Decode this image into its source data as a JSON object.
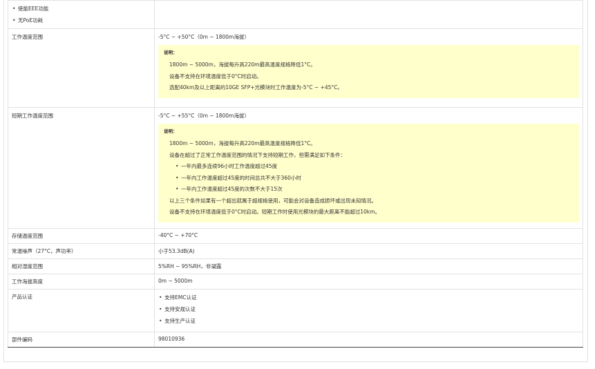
{
  "top_features": [
    "使能EEE功能",
    "无PoE功耗"
  ],
  "rows": {
    "op_temp": {
      "key": "工作温度范围",
      "value": "-5°C ~ +50°C（0m ~ 1800m海拔）",
      "note_label": "说明：",
      "note_lines": [
        "1800m ~ 5000m，海拔每升高220m最高温度规格降低1°C。",
        "设备不支持在环境温度低于0°C时启动。",
        "选配40km及以上距离的10GE SFP+光模块时工作温度为-5°C ~ +45°C。"
      ]
    },
    "short_temp": {
      "key": "短期工作温度范围",
      "value": "-5°C ~ +55°C（0m ~ 1800m海拔）",
      "note_label": "说明：",
      "note_line1": "1800m ~ 5000m，海拔每升高220m最高温度规格降低1°C。",
      "note_line2": "设备在超过了正常工作温度范围的情况下支持短期工作，但需满足如下条件：",
      "conditions": [
        "一年内最多连续96小时工作温度超过45度",
        "一年内工作温度超过45度的时间总共不大于360小时",
        "一年内工作温度超过45度的次数不大于15次"
      ],
      "note_line3": "以上三个条件如果有一个超出就属于超规格使用，可能会对设备造成损坏或出现未知情况。",
      "note_line4": "设备不支持在环境温度低于0°C时启动。短期工作时使用光模块的最大距离不能超过10km。"
    },
    "storage_temp": {
      "key": "存储温度范围",
      "value": "-40°C ~ +70°C"
    },
    "noise": {
      "key": "常温噪声（27°C，声功率）",
      "value": "小于53.3dB(A)"
    },
    "humidity": {
      "key": "相对湿度范围",
      "value": "5%RH ~ 95%RH，非凝露"
    },
    "altitude": {
      "key": "工作海拔高度",
      "value": "0m ~ 5000m"
    },
    "certification": {
      "key": "产品认证",
      "items": [
        "支持EMC认证",
        "支持安规认证",
        "支持生产认证"
      ]
    },
    "part_no": {
      "key": "部件编码",
      "value": "98010936"
    }
  }
}
